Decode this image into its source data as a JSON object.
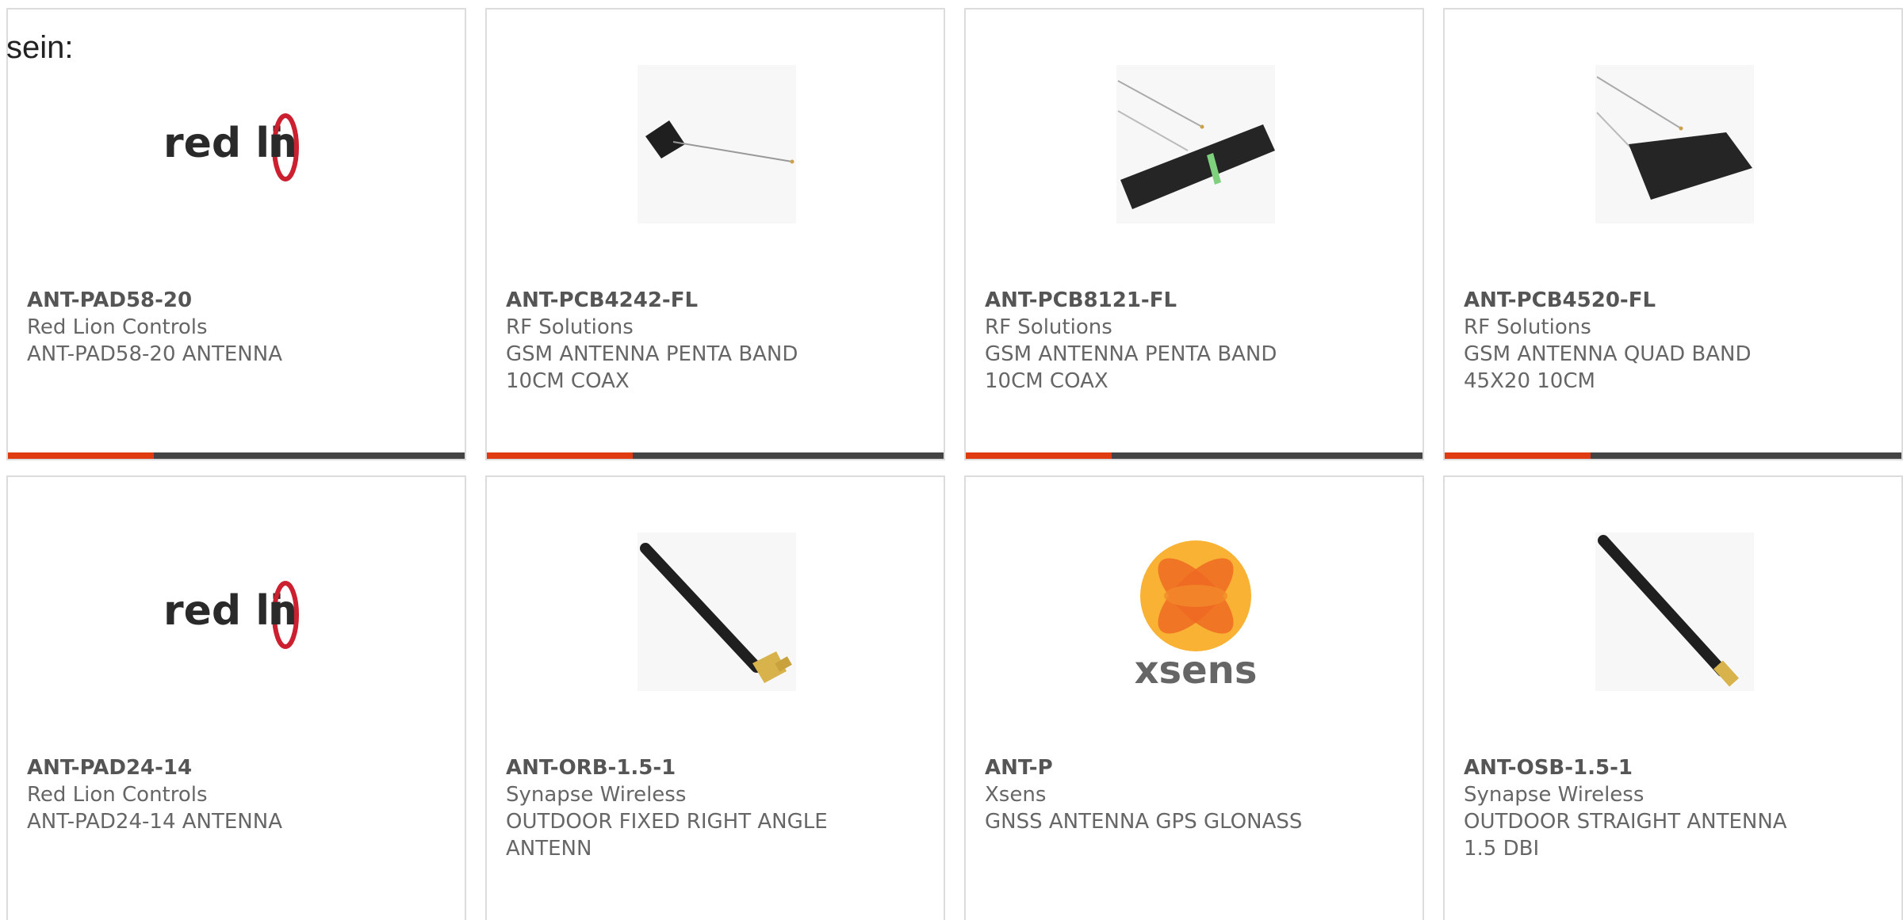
{
  "intro_text": "sein:",
  "colors": {
    "accent": "#e03a10",
    "bar": "#444444",
    "border": "#dcdcdc"
  },
  "products": [
    {
      "part": "ANT-PAD58-20",
      "maker": "Red Lion Controls",
      "desc1": "ANT-PAD58-20 ANTENNA",
      "desc2": "",
      "image": "red-lion-logo",
      "accent_fraction": 0.32
    },
    {
      "part": "ANT-PCB4242-FL",
      "maker": "RF Solutions",
      "desc1": "GSM ANTENNA PENTA BAND",
      "desc2": "10CM COAX",
      "image": "pcb-antenna-small",
      "accent_fraction": 0.32
    },
    {
      "part": "ANT-PCB8121-FL",
      "maker": "RF Solutions",
      "desc1": "GSM ANTENNA PENTA BAND",
      "desc2": "10CM COAX",
      "image": "pcb-antenna-long",
      "accent_fraction": 0.32
    },
    {
      "part": "ANT-PCB4520-FL",
      "maker": "RF Solutions",
      "desc1": "GSM ANTENNA QUAD BAND",
      "desc2": "45X20 10CM",
      "image": "pcb-antenna-quad",
      "accent_fraction": 0.32
    },
    {
      "part": "ANT-PAD24-14",
      "maker": "Red Lion Controls",
      "desc1": "ANT-PAD24-14 ANTENNA",
      "desc2": "",
      "image": "red-lion-logo"
    },
    {
      "part": "ANT-ORB-1.5-1",
      "maker": "Synapse Wireless",
      "desc1": "OUTDOOR FIXED RIGHT ANGLE",
      "desc2": "ANTENN",
      "image": "whip-antenna-right-angle"
    },
    {
      "part": "ANT-P",
      "maker": "Xsens",
      "desc1": "GNSS ANTENNA GPS GLONASS",
      "desc2": "",
      "image": "xsens-logo"
    },
    {
      "part": "ANT-OSB-1.5-1",
      "maker": "Synapse Wireless",
      "desc1": "OUTDOOR STRAIGHT ANTENNA",
      "desc2": "1.5 DBI",
      "image": "whip-antenna-straight"
    }
  ],
  "logo_text": {
    "redlion_a": "red li",
    "redlion_b": "n",
    "xsens": "xsens"
  }
}
